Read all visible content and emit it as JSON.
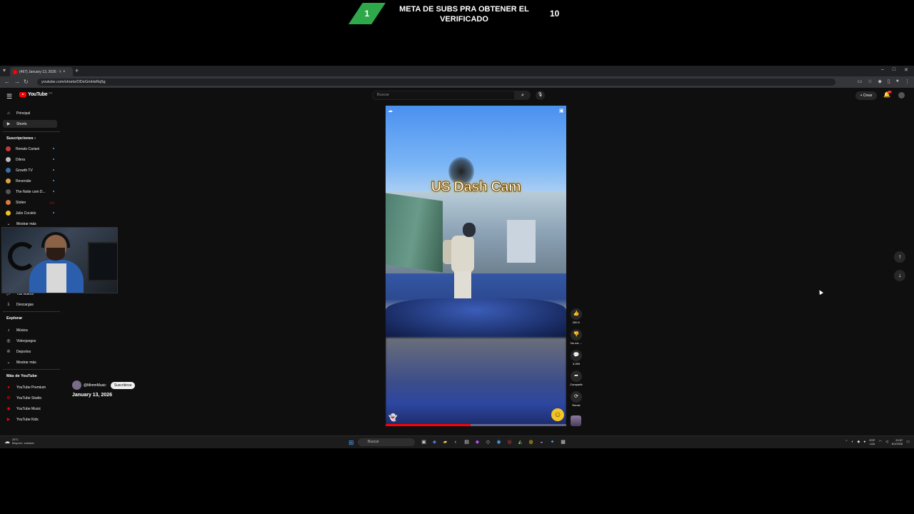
{
  "overlay": {
    "goal_current": "1",
    "goal_title": "META DE SUBS PRA OBTENER EL VERIFICADO",
    "goal_target": "10",
    "goal_color": "#2fa84a"
  },
  "browser": {
    "tab_title": "(467) January 13, 2026 · Yo",
    "url": "youtube.com/shorts/ODeGmHsRq5g",
    "new_tab": "+"
  },
  "youtube": {
    "logo_text": "YouTube",
    "region": "PT",
    "search_placeholder": "Buscar",
    "create_label": "Crear",
    "notifications_badge": "9+"
  },
  "sidebar": {
    "main": [
      {
        "label": "Principal",
        "icon": "home-icon"
      },
      {
        "label": "Shorts",
        "icon": "shorts-icon"
      }
    ],
    "subs_header": "Suscripciones",
    "subscriptions": [
      {
        "label": "Renato Cariani",
        "color": "#c23b3b",
        "indicator": "dot"
      },
      {
        "label": "Dilera",
        "color": "#bbbbbb",
        "indicator": "dot"
      },
      {
        "label": "Growth TV",
        "color": "#3a6ea5",
        "indicator": "dot"
      },
      {
        "label": "Reversão",
        "color": "#d9a441",
        "indicator": "dot"
      },
      {
        "label": "The Noite com D...",
        "color": "#555555",
        "indicator": "dot"
      },
      {
        "label": "Stolen",
        "color": "#e07b39",
        "indicator": "live"
      },
      {
        "label": "Julio Cocielo",
        "color": "#f0c419",
        "indicator": "dot"
      }
    ],
    "show_more_subs": "Mostrar más",
    "you_items": [
      {
        "label": "Tus videos",
        "icon": "video-icon"
      },
      {
        "label": "Descargas",
        "icon": "download-icon"
      }
    ],
    "explore_header": "Explorar",
    "explore": [
      {
        "label": "Música",
        "icon": "music-icon"
      },
      {
        "label": "Videojuegos",
        "icon": "gamepad-icon"
      },
      {
        "label": "Deportes",
        "icon": "trophy-icon"
      },
      {
        "label": "Mostrar más",
        "icon": "chevron-down-icon"
      }
    ],
    "more_header": "Más de YouTube",
    "more": [
      {
        "label": "YouTube Premium"
      },
      {
        "label": "YouTube Studio"
      },
      {
        "label": "YouTube Music"
      },
      {
        "label": "YouTube Kids"
      }
    ]
  },
  "short": {
    "overlay_title": "US Dash Cam",
    "channel_name": "@MimmMusic",
    "subscribe_label": "Suscribirse",
    "video_date": "January 13, 2026",
    "progress_fraction": 0.47
  },
  "actions": {
    "like_count": "200 K",
    "dislike_label": "No me ...",
    "comment_count": "3,399",
    "share_label": "Compartir",
    "remix_label": "Remix"
  },
  "taskbar": {
    "weather_temp": "26°C",
    "weather_desc": "Mayorm. soleado",
    "search_placeholder": "Buscar",
    "lang_line1": "ESP",
    "lang_line2": "LAA",
    "time": "20:57",
    "date": "6/1/2026"
  }
}
